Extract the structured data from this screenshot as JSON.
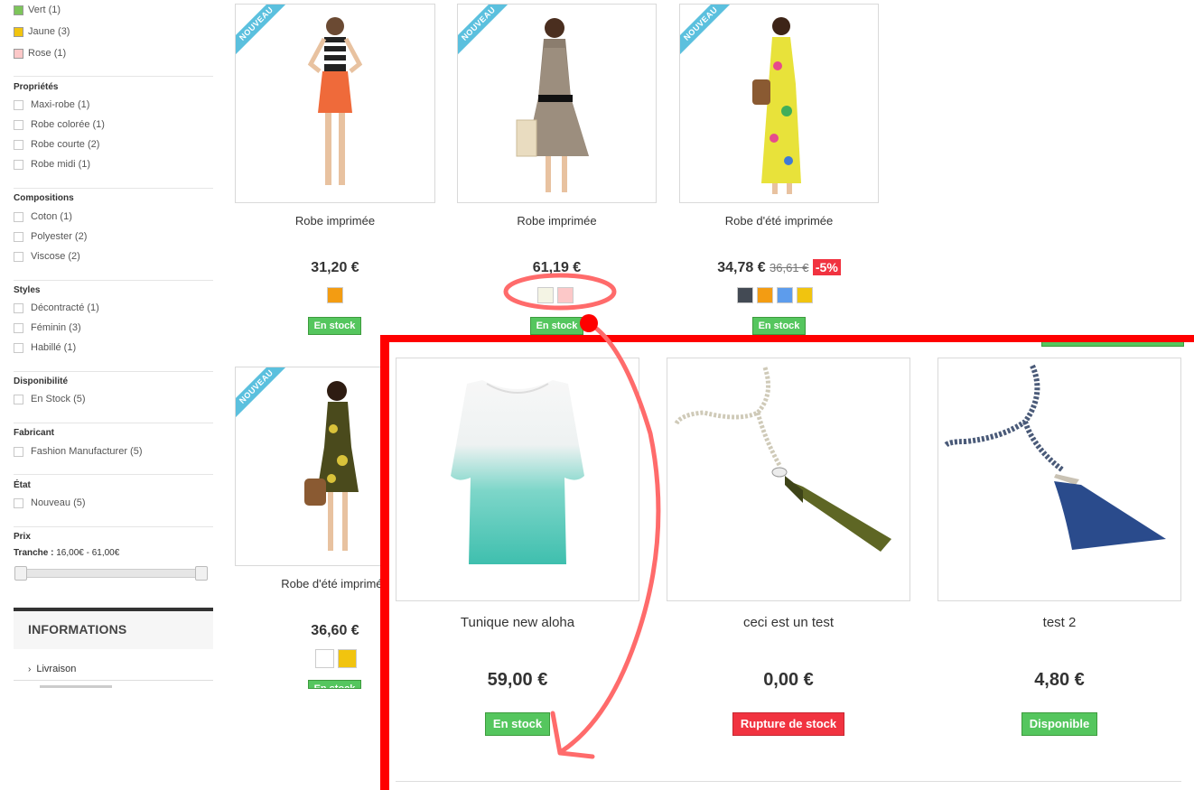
{
  "filters": {
    "colors": [
      {
        "label": "Vert (1)",
        "color": "#7dc55a"
      },
      {
        "label": "Jaune (3)",
        "color": "#f1c40f"
      },
      {
        "label": "Rose (1)",
        "color": "#fcc8c8"
      }
    ],
    "groups": [
      {
        "title": "Propriétés",
        "items": [
          "Maxi-robe (1)",
          "Robe colorée (1)",
          "Robe courte (2)",
          "Robe midi (1)"
        ]
      },
      {
        "title": "Compositions",
        "items": [
          "Coton (1)",
          "Polyester (2)",
          "Viscose (2)"
        ]
      },
      {
        "title": "Styles",
        "items": [
          "Décontracté (1)",
          "Féminin (3)",
          "Habillé (1)"
        ]
      },
      {
        "title": "Disponibilité",
        "items": [
          "En Stock (5)"
        ]
      },
      {
        "title": "Fabricant",
        "items": [
          "Fashion Manufacturer (5)"
        ]
      },
      {
        "title": "État",
        "items": [
          "Nouveau (5)"
        ]
      }
    ],
    "price": {
      "title": "Prix",
      "range_label": "Tranche :",
      "range_value": "16,00€ - 61,00€"
    }
  },
  "informations": {
    "title": "INFORMATIONS",
    "link": "Livraison"
  },
  "products": [
    {
      "name": "Robe imprimée",
      "price": "31,20 €",
      "badge": "NOUVEAU",
      "colors": [
        "#f39c12"
      ],
      "stock": "En stock"
    },
    {
      "name": "Robe imprimée",
      "price": "61,19 €",
      "badge": "NOUVEAU",
      "colors": [
        "#f4f4e4",
        "#fcc8c8"
      ],
      "stock": "En stock"
    },
    {
      "name": "Robe d'été imprimée",
      "price": "34,78 €",
      "old_price": "36,61 €",
      "discount": "-5%",
      "badge": "NOUVEAU",
      "colors": [
        "#434a54",
        "#f39c12",
        "#5d9cec",
        "#f1c40f"
      ],
      "stock": "En stock"
    },
    {
      "name": "Robe d'été imprimée",
      "price": "36,60 €",
      "badge": "NOUVEAU",
      "colors": [
        "#ffffff",
        "#f1c40f"
      ],
      "stock": "En stock"
    }
  ],
  "overlay_products": [
    {
      "name": "Tunique new aloha",
      "price": "59,00 €",
      "stock": "En stock",
      "status": "in"
    },
    {
      "name": "ceci est un test",
      "price": "0,00 €",
      "stock": "Rupture de stock",
      "status": "out"
    },
    {
      "name": "test 2",
      "price": "4,80 €",
      "stock": "Disponible",
      "status": "in"
    }
  ],
  "annotation": {
    "highlight_color": "#ff0000",
    "arrow_color": "#ff6b6b"
  }
}
